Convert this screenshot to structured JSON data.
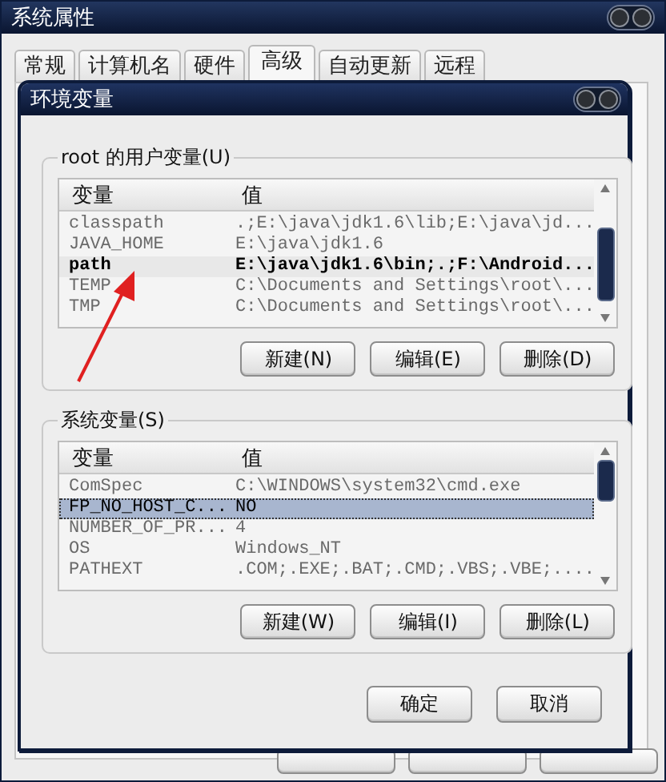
{
  "window": {
    "title": "系统属性"
  },
  "tabs": [
    {
      "label": "常规",
      "selected": false
    },
    {
      "label": "计算机名",
      "selected": false
    },
    {
      "label": "硬件",
      "selected": false
    },
    {
      "label": "高级",
      "selected": true
    },
    {
      "label": "自动更新",
      "selected": false
    },
    {
      "label": "远程",
      "selected": false
    }
  ],
  "dialog": {
    "title": "环境变量",
    "groups": [
      {
        "label": "root 的用户变量(U)",
        "focused": false,
        "columns": [
          "变量",
          "值"
        ],
        "rows": [
          {
            "name": "classpath",
            "value": ".;E:\\java\\jdk1.6\\lib;E:\\java\\jd...",
            "selected": false
          },
          {
            "name": "JAVA_HOME",
            "value": "E:\\java\\jdk1.6",
            "selected": false
          },
          {
            "name": "path",
            "value": "E:\\java\\jdk1.6\\bin;.;F:\\Android...",
            "selected": true
          },
          {
            "name": "TEMP",
            "value": "C:\\Documents and Settings\\root\\...",
            "selected": false
          },
          {
            "name": "TMP",
            "value": "C:\\Documents and Settings\\root\\...",
            "selected": false
          }
        ],
        "buttons": [
          "新建(N)",
          "编辑(E)",
          "删除(D)"
        ]
      },
      {
        "label": "系统变量(S)",
        "focused": true,
        "columns": [
          "变量",
          "值"
        ],
        "rows": [
          {
            "name": "ComSpec",
            "value": "C:\\WINDOWS\\system32\\cmd.exe",
            "selected": false
          },
          {
            "name": "FP_NO_HOST_C...",
            "value": "NO",
            "selected": true
          },
          {
            "name": "NUMBER_OF_PR...",
            "value": "4",
            "selected": false
          },
          {
            "name": "OS",
            "value": "Windows_NT",
            "selected": false
          },
          {
            "name": "PATHEXT",
            "value": ".COM;.EXE;.BAT;.CMD;.VBS;.VBE;....",
            "selected": false
          }
        ],
        "buttons": [
          "新建(W)",
          "编辑(I)",
          "删除(L)"
        ]
      }
    ],
    "buttons": [
      "确定",
      "取消"
    ]
  }
}
